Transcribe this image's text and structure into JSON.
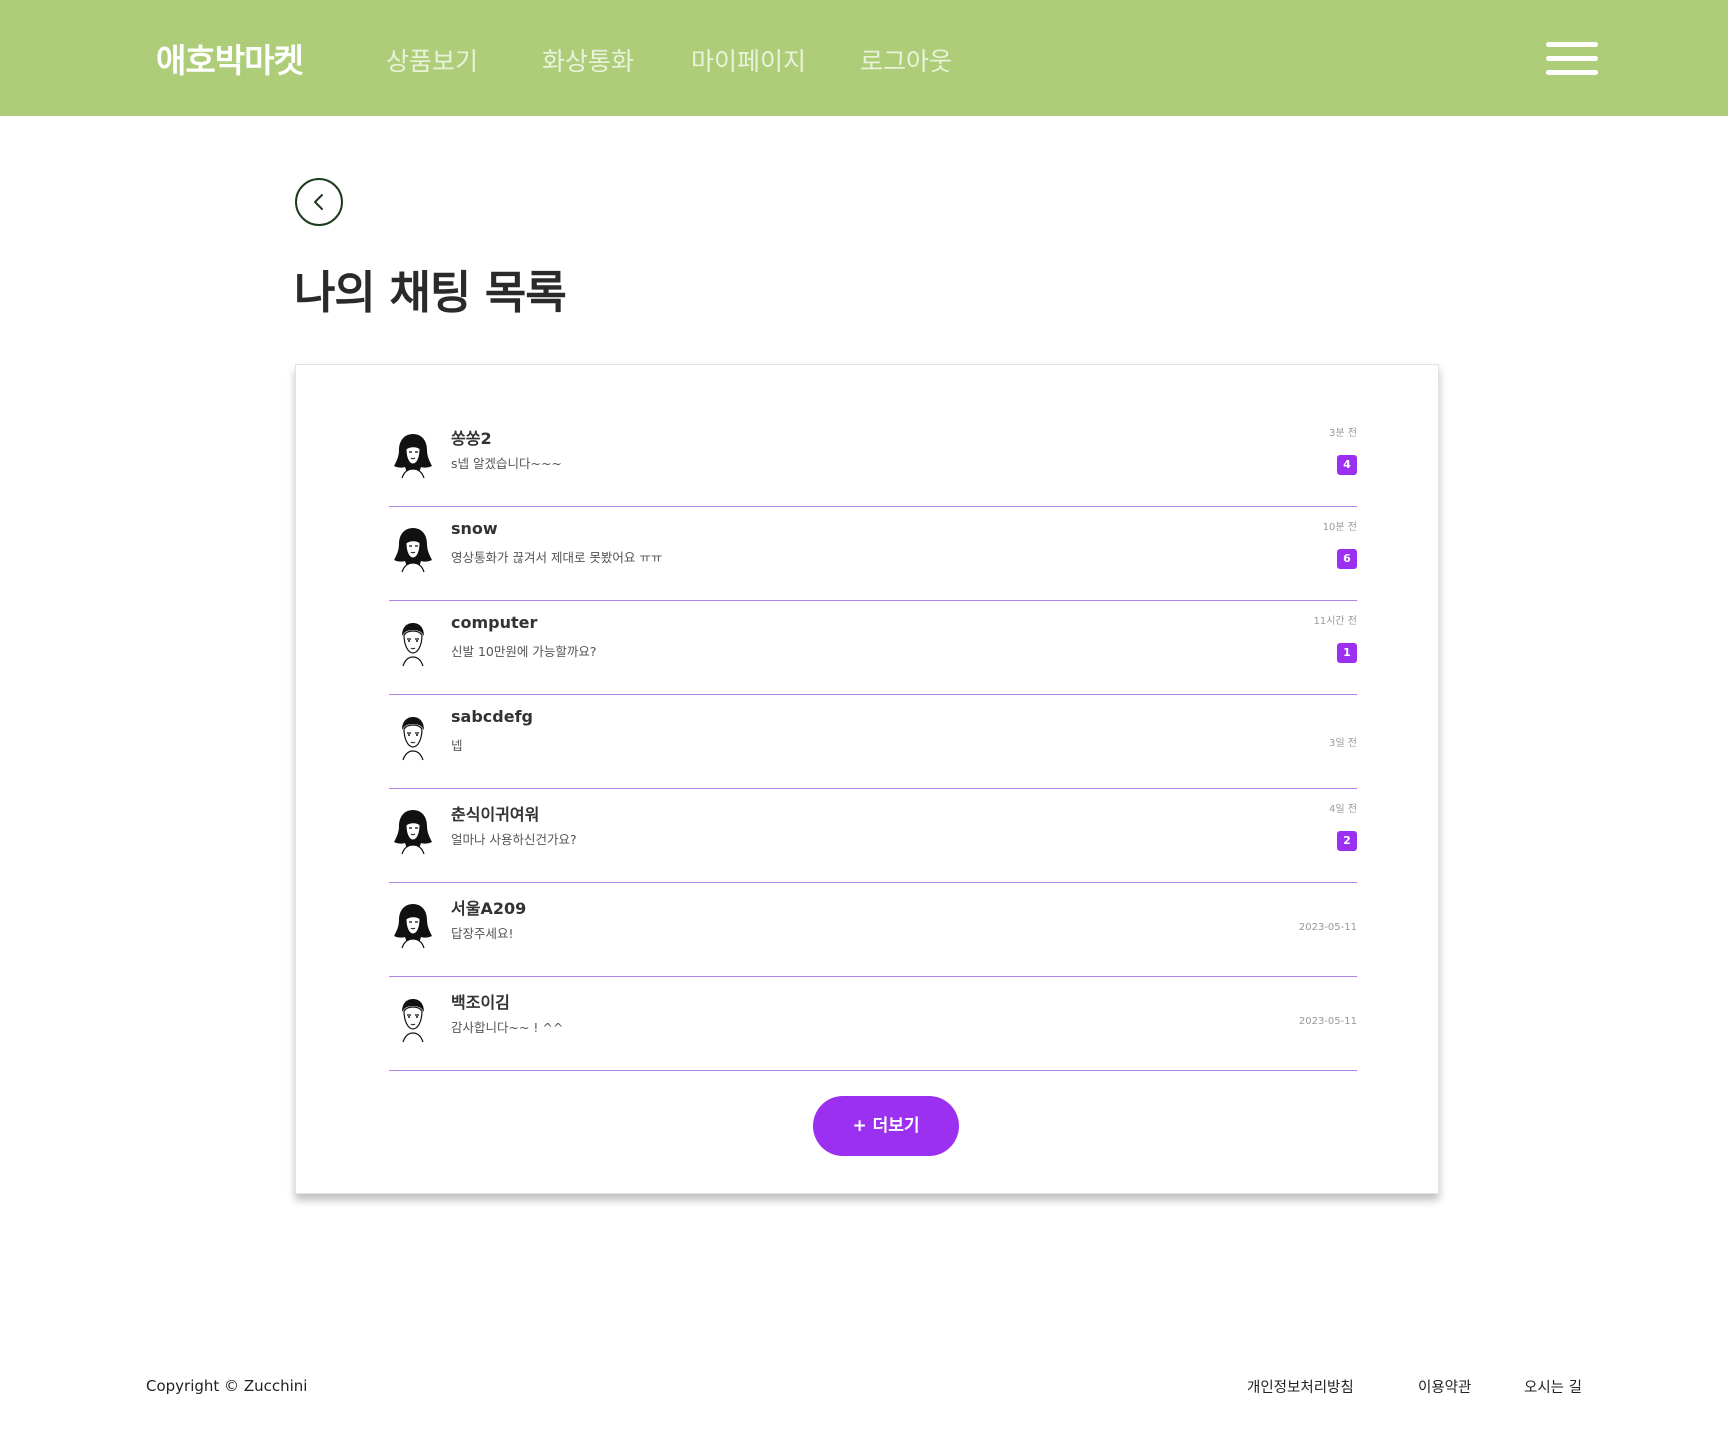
{
  "header": {
    "logo": "애호박마켓",
    "nav": [
      "상품보기",
      "화상통화",
      "마이페이지",
      "로그아웃"
    ]
  },
  "page_title": "나의 채팅 목록",
  "chats": [
    {
      "name": "쏭쏭2",
      "message": "s넵 알겠습니다~~~",
      "time": "3분 전",
      "unread": "4",
      "avatar": "woman-avatar"
    },
    {
      "name": "snow",
      "message": "영상통화가 끊겨서 제대로 못봤어요 ㅠㅠ",
      "time": "10분 전",
      "unread": "6",
      "avatar": "woman-avatar"
    },
    {
      "name": "computer",
      "message": "신발 10만원에 가능할까요?",
      "time": "11시간 전",
      "unread": "1",
      "avatar": "man-avatar"
    },
    {
      "name": "sabcdefg",
      "message": "넵",
      "time": "3일 전",
      "unread": "",
      "avatar": "man-avatar"
    },
    {
      "name": "춘식이귀여워",
      "message": "얼마나 사용하신건가요?",
      "time": "4일 전",
      "unread": "2",
      "avatar": "woman-avatar"
    },
    {
      "name": "서울A209",
      "message": "답장주세요!",
      "time": "2023-05-11",
      "unread": "",
      "avatar": "woman-avatar"
    },
    {
      "name": "백조이김",
      "message": "감사합니다~~ ! ^^",
      "time": "2023-05-11",
      "unread": "",
      "avatar": "man-avatar"
    }
  ],
  "more_button": "+ 더보기",
  "footer": {
    "copyright": "Copyright © Zucchini",
    "links": [
      "개인정보처리방침",
      "이용약관",
      "오시는 길"
    ]
  },
  "colors": {
    "header_bg": "#adcd78",
    "accent": "#9b30f0",
    "divider": "#b083e8"
  },
  "icons": {
    "back": "chevron-left-icon",
    "menu": "hamburger-menu-icon"
  }
}
